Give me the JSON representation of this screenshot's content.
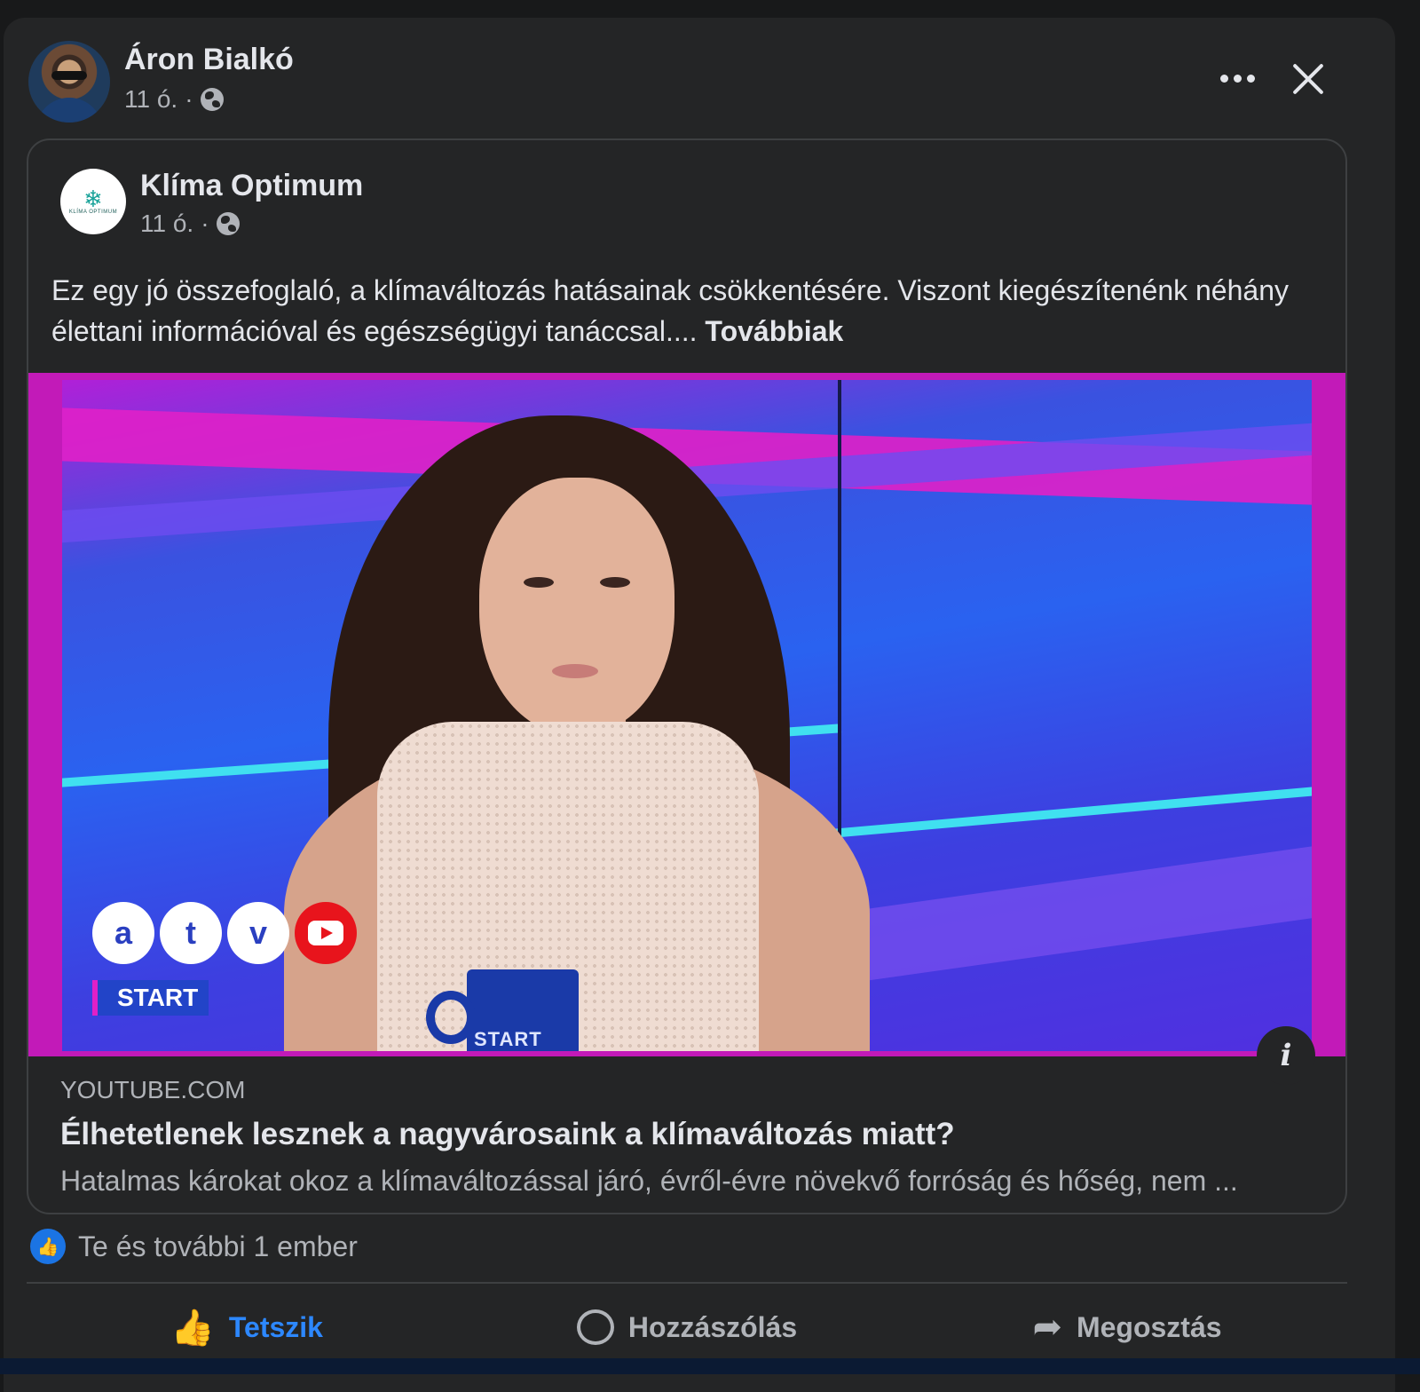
{
  "sharer": {
    "name": "Áron Bialkó",
    "time": "11 ó.",
    "separator": "·",
    "audience_icon": "globe-icon"
  },
  "header_controls": {
    "more_icon": "more-horizontal-icon",
    "close_icon": "close-icon"
  },
  "shared_post": {
    "page_name": "Klíma Optimum",
    "time": "11 ó.",
    "separator": "·",
    "logo_text": "KLÍMA OPTIMUM",
    "text": "Ez egy jó összefoglaló, a klímaváltozás hatásainak csökkentésére. Viszont kiegészítenénk néhány élettani információval és egészségügyi tanáccsal.... ",
    "see_more": "Továbbiak"
  },
  "thumbnail": {
    "channel_letters": [
      "a",
      "t",
      "v"
    ],
    "show_badge": "START",
    "mug_text": "START"
  },
  "link_preview": {
    "domain": "YOUTUBE.COM",
    "title": "Élhetetlenek lesznek a nagyvárosaink a klímaváltozás miatt?",
    "description": "Hatalmas károkat okoz a klímaváltozással járó, évről-évre növekvő forróság és hőség, nem ..."
  },
  "reactions": {
    "text": "Te és további 1 ember",
    "icon": "like-icon"
  },
  "actions": [
    {
      "label": "Tetszik",
      "icon": "like-icon",
      "active": true
    },
    {
      "label": "Hozzászólás",
      "icon": "comment-icon",
      "active": false
    },
    {
      "label": "Megosztás",
      "icon": "share-icon",
      "active": false
    }
  ],
  "colors": {
    "background": "#242526",
    "accent": "#2d88ff",
    "text_primary": "#e4e6eb",
    "text_secondary": "#b0b3b8"
  }
}
